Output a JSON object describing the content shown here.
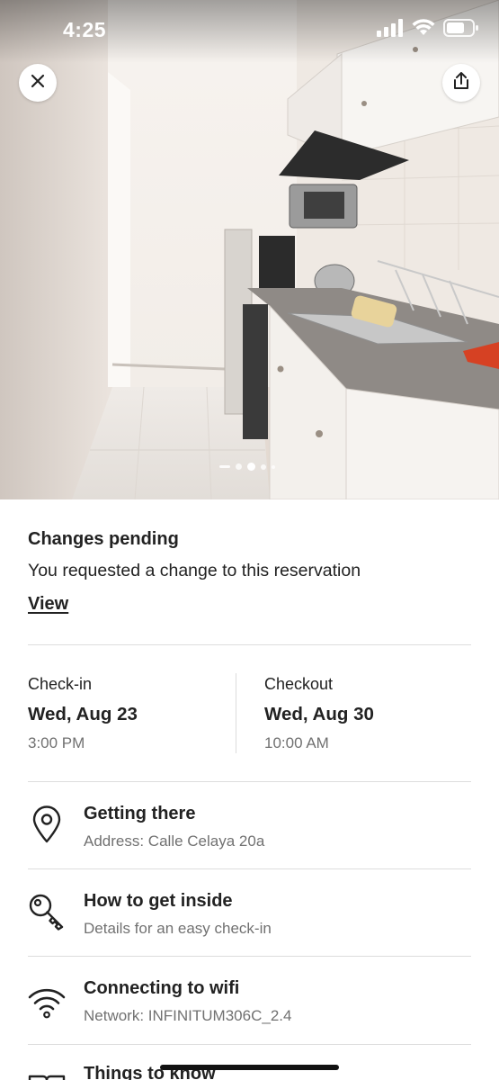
{
  "status_bar": {
    "time": "4:25",
    "icons": [
      "cellular-signal-icon",
      "wifi-icon",
      "battery-icon"
    ]
  },
  "hero": {
    "photo": "kitchen-photo",
    "actions": [
      "close-icon",
      "share-icon"
    ],
    "pagination": {
      "count": 4,
      "active_index": 1
    }
  },
  "pending": {
    "title": "Changes pending",
    "text": "You requested a change to this reservation",
    "link": "View"
  },
  "checkin": {
    "label": "Check-in",
    "date": "Wed, Aug 23",
    "time": "3:00 PM"
  },
  "checkout": {
    "label": "Checkout",
    "date": "Wed, Aug 30",
    "time": "10:00 AM"
  },
  "rows": [
    {
      "title": "Getting there",
      "subtitle": "Address: Calle Celaya 20a",
      "icon": "location-pin-icon"
    },
    {
      "title": "How to get inside",
      "subtitle": "Details for an easy check-in",
      "icon": "key-icon"
    },
    {
      "title": "Connecting to wifi",
      "subtitle": "Network: INFINITUM306C_2.4",
      "icon": "wifi-icon"
    },
    {
      "title": "Things to know",
      "subtitle": "",
      "icon": "book-icon"
    }
  ],
  "colors": {
    "text_primary": "#222222",
    "text_secondary": "#717171",
    "divider": "#dddddd"
  }
}
